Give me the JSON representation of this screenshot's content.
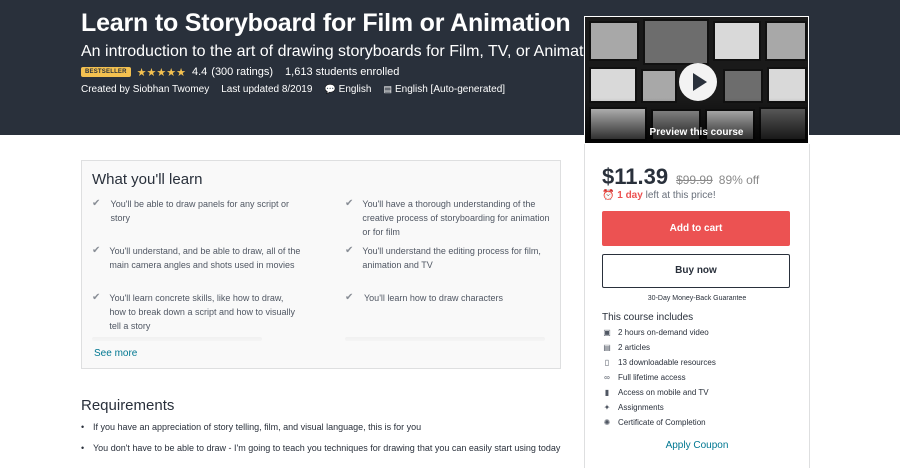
{
  "hero": {
    "title": "Learn to Storyboard for Film or Animation",
    "subtitle": "An introduction to the art of drawing storyboards for Film, TV, or Animation",
    "badge": "BESTSELLER",
    "stars": "★★★★★",
    "rating": "4.4",
    "ratings_count": "(300 ratings)",
    "enrolled": "1,613 students enrolled",
    "created_by": "Created by Siobhan Twomey",
    "last_updated": "Last updated 8/2019",
    "language": "English",
    "captions": "English [Auto-generated]"
  },
  "preview": {
    "label": "Preview this course"
  },
  "sidebar": {
    "price": "$11.39",
    "original_price": "$99.99",
    "discount": "89% off",
    "timer_bold": "1 day",
    "timer_rest": "left at this price!",
    "add_to_cart": "Add to cart",
    "buy_now": "Buy now",
    "guarantee": "30-Day Money-Back Guarantee",
    "includes_title": "This course includes",
    "includes": [
      {
        "icon": "video-icon",
        "glyph": "▣",
        "label": "2 hours on-demand video"
      },
      {
        "icon": "article-icon",
        "glyph": "▤",
        "label": "2 articles"
      },
      {
        "icon": "file-icon",
        "glyph": "▯",
        "label": "13 downloadable resources"
      },
      {
        "icon": "infinity-icon",
        "glyph": "∞",
        "label": "Full lifetime access"
      },
      {
        "icon": "mobile-icon",
        "glyph": "▮",
        "label": "Access on mobile and TV"
      },
      {
        "icon": "assignment-icon",
        "glyph": "✦",
        "label": "Assignments"
      },
      {
        "icon": "certificate-icon",
        "glyph": "✺",
        "label": "Certificate of Completion"
      }
    ],
    "coupon": "Apply Coupon"
  },
  "learn": {
    "title": "What you'll learn",
    "items": [
      "You'll be able to draw panels for any script or story",
      "You'll have a thorough understanding of the creative process of storyboarding for animation or for film",
      "You'll understand, and be able to draw, all of the main camera angles and shots used in movies",
      "You'll understand the editing process for film, animation and TV",
      "You'll learn concrete skills, like how to draw, how to break down a script and how to visually tell a story",
      "You'll learn how to draw characters"
    ],
    "see_more": "See more"
  },
  "requirements": {
    "title": "Requirements",
    "items": [
      "If you have an appreciation of story telling, film, and visual language, this is for you",
      "You don't have to be able to draw - I'm going to teach you techniques for drawing that you can easily start using today"
    ]
  },
  "colors": {
    "hero_bg": "#29303b",
    "accent_red": "#ec5252",
    "badge_yellow": "#f4c150",
    "link_blue": "#007791"
  }
}
